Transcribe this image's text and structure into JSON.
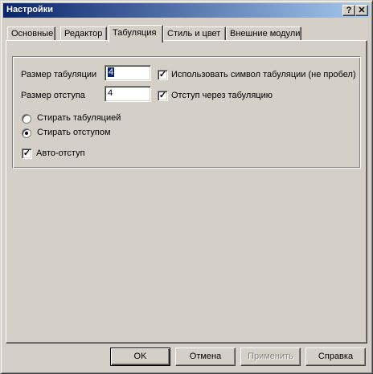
{
  "window": {
    "title": "Настройки",
    "help_glyph": "?",
    "close_glyph": "✕"
  },
  "tabs": [
    {
      "label": "Основные",
      "active": false
    },
    {
      "label": "Редактор",
      "active": false
    },
    {
      "label": "Табуляция",
      "active": true
    },
    {
      "label": "Стиль и цвет",
      "active": false
    },
    {
      "label": "Внешние модули",
      "active": false
    }
  ],
  "settings": {
    "tab_size_label": "Размер табуляции",
    "tab_size_value": "4",
    "indent_size_label": "Размер отступа",
    "indent_size_value": "4",
    "use_tab_char_label": "Использовать символ табуляции (не пробел)",
    "use_tab_char_checked": true,
    "indent_with_tab_label": "Отступ через табуляцию",
    "indent_with_tab_checked": true,
    "erase_tab_label": "Стирать табуляцией",
    "erase_indent_label": "Стирать отступом",
    "erase_selected": "indent",
    "auto_indent_label": "Авто-отступ",
    "auto_indent_checked": true,
    "check_glyph": "✓"
  },
  "buttons": {
    "ok": "OK",
    "cancel": "Отмена",
    "apply": "Применить",
    "help": "Справка"
  }
}
